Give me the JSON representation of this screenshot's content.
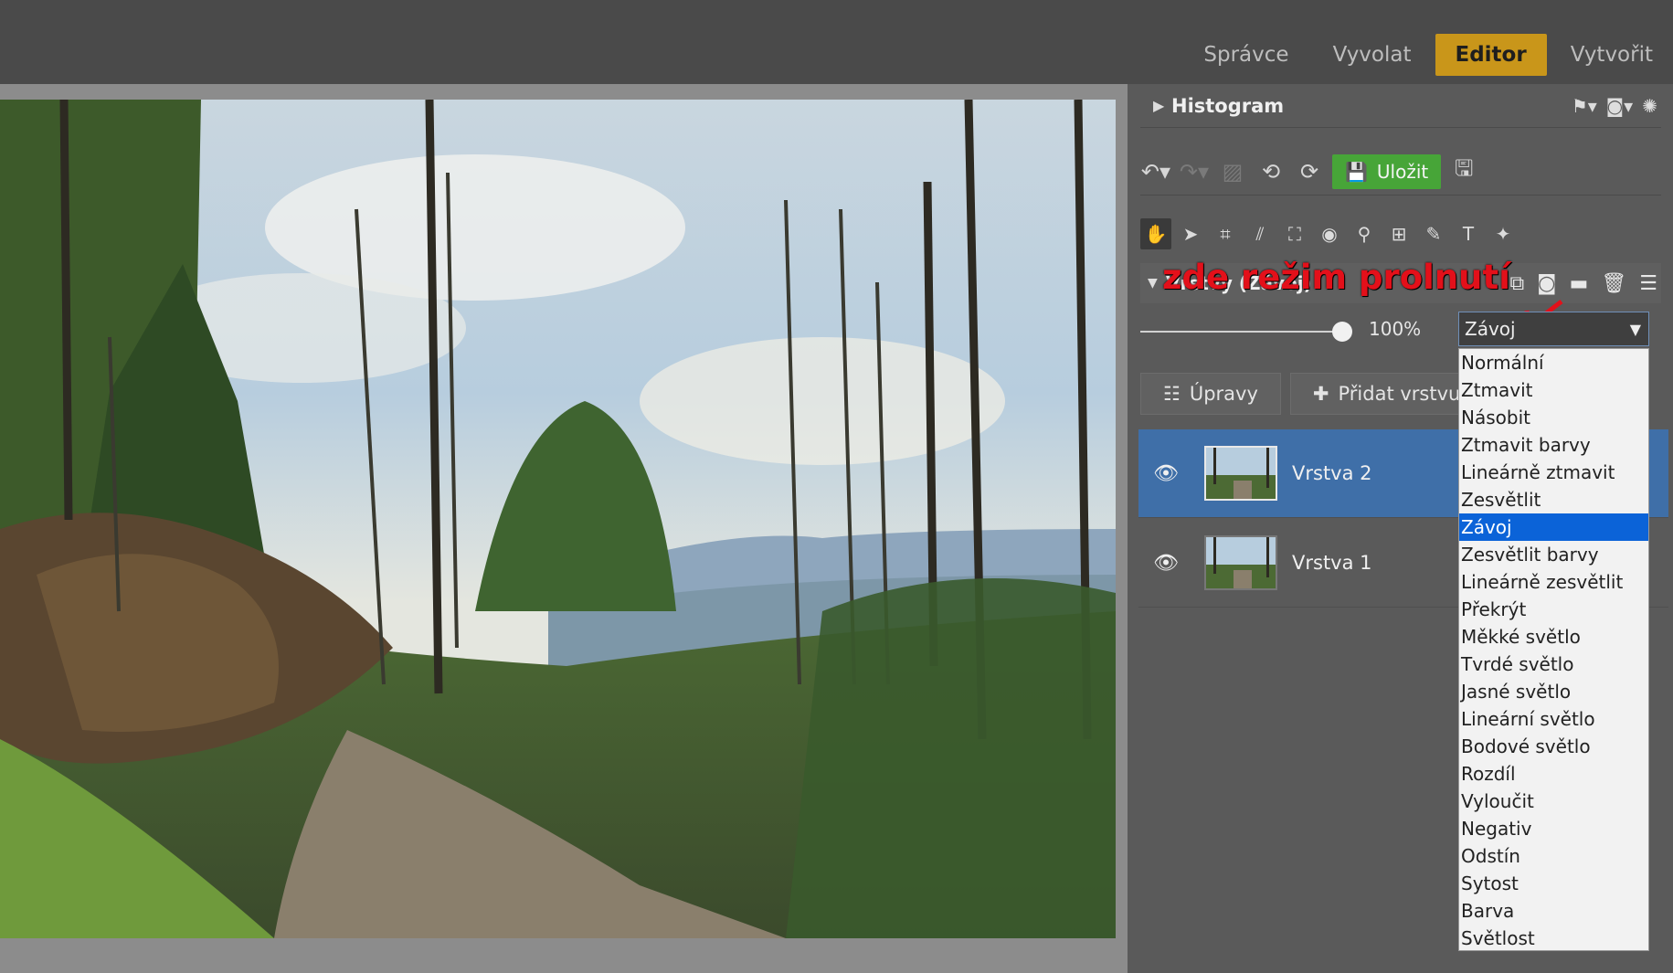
{
  "tabs": [
    "Správce",
    "Vyvolat",
    "Editor",
    "Vytvořit"
  ],
  "active_tab": "Editor",
  "histogram": {
    "title": "Histogram"
  },
  "toolbar": {
    "save_label": "Uložit"
  },
  "layers": {
    "title": "Vrstvy (Závoj)",
    "opacity": "100%",
    "blend_mode": "Závoj",
    "btn_adjust": "Úpravy",
    "btn_add": "Přidat vrstvu",
    "items": [
      {
        "name": "Vrstva 2",
        "selected": true
      },
      {
        "name": "Vrstva 1",
        "selected": false
      }
    ]
  },
  "annotation": "zde režim prolnutí",
  "blend_modes": [
    "Normální",
    "Ztmavit",
    "Násobit",
    "Ztmavit barvy",
    "Lineárně ztmavit",
    "Zesvětlit",
    "Závoj",
    "Zesvětlit barvy",
    "Lineárně zesvětlit",
    "Překrýt",
    "Měkké světlo",
    "Tvrdé světlo",
    "Jasné světlo",
    "Lineární světlo",
    "Bodové světlo",
    "Rozdíl",
    "Vyloučit",
    "Negativ",
    "Odstín",
    "Sytost",
    "Barva",
    "Světlost"
  ],
  "colors": {
    "accent": "#c9961a",
    "save_green": "#47a538",
    "selection_blue": "#3f6fa8",
    "annotation_red": "#e3101a"
  }
}
